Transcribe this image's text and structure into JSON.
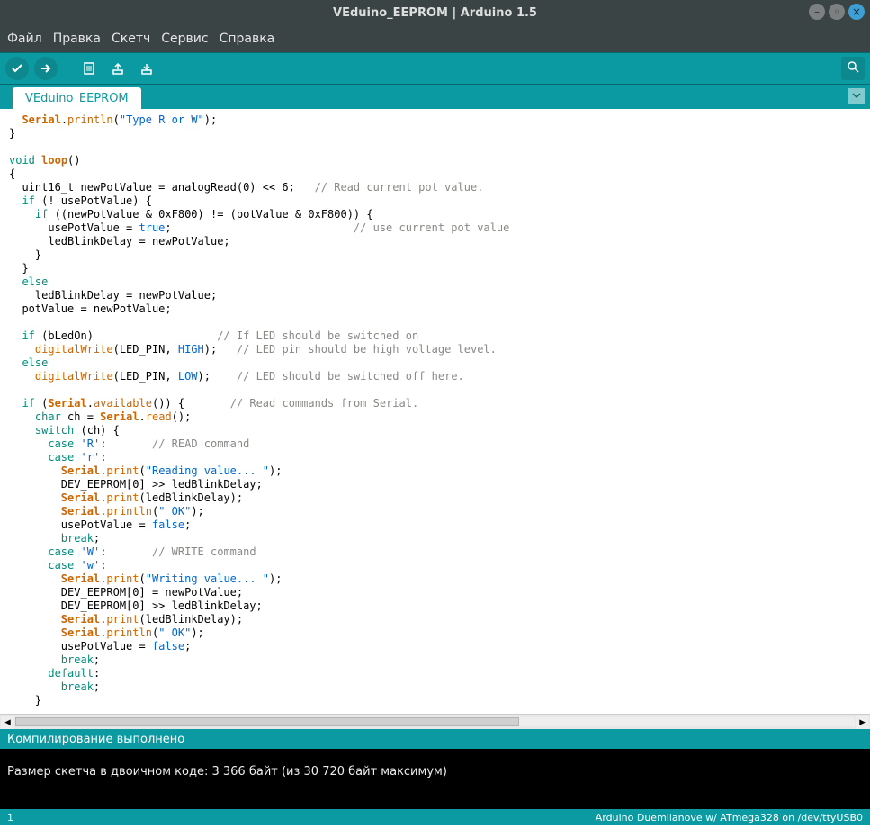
{
  "window": {
    "title": "VEduino_EEPROM | Arduino 1.5"
  },
  "menu": {
    "file": "Файл",
    "edit": "Правка",
    "sketch": "Скетч",
    "tools": "Сервис",
    "help": "Справка"
  },
  "tabs": {
    "main": "VEduino_EEPROM"
  },
  "code": {
    "l1_a": "  ",
    "l1_b": "Serial",
    "l1_c": ".",
    "l1_d": "println",
    "l1_e": "(",
    "l1_f": "\"Type R or W\"",
    "l1_g": ");",
    "l2": "}",
    "l3": "",
    "l4_a": "void",
    "l4_b": " ",
    "l4_c": "loop",
    "l4_d": "()",
    "l5": "{",
    "l6_a": "  uint16_t newPotValue = analogRead(0) << 6;   ",
    "l6_b": "// Read current pot value.",
    "l7_a": "  ",
    "l7_b": "if",
    "l7_c": " (! usePotValue) {",
    "l8_a": "    ",
    "l8_b": "if",
    "l8_c": " ((newPotValue & 0xF800) != (potValue & 0xF800)) {",
    "l9_a": "      usePotValue = ",
    "l9_b": "true",
    "l9_c": ";                            ",
    "l9_d": "// use current pot value",
    "l10": "      ledBlinkDelay = newPotValue;",
    "l11": "    }",
    "l12": "  }",
    "l13_a": "  ",
    "l13_b": "else",
    "l14": "    ledBlinkDelay = newPotValue;",
    "l15": "  potValue = newPotValue;",
    "l16": "",
    "l17_a": "  ",
    "l17_b": "if",
    "l17_c": " (bLedOn)                   ",
    "l17_d": "// If LED should be switched on",
    "l18_a": "    ",
    "l18_b": "digitalWrite",
    "l18_c": "(LED_PIN, ",
    "l18_d": "HIGH",
    "l18_e": ");   ",
    "l18_f": "// LED pin should be high voltage level.",
    "l19_a": "  ",
    "l19_b": "else",
    "l20_a": "    ",
    "l20_b": "digitalWrite",
    "l20_c": "(LED_PIN, ",
    "l20_d": "LOW",
    "l20_e": ");    ",
    "l20_f": "// LED should be switched off here.",
    "l21": "",
    "l22_a": "  ",
    "l22_b": "if",
    "l22_c": " (",
    "l22_d": "Serial",
    "l22_e": ".",
    "l22_f": "available",
    "l22_g": "()) {       ",
    "l22_h": "// Read commands from Serial.",
    "l23_a": "    ",
    "l23_b": "char",
    "l23_c": " ch = ",
    "l23_d": "Serial",
    "l23_e": ".",
    "l23_f": "read",
    "l23_g": "();",
    "l24_a": "    ",
    "l24_b": "switch",
    "l24_c": " (ch) {",
    "l25_a": "      ",
    "l25_b": "case",
    "l25_c": " ",
    "l25_d": "'R'",
    "l25_e": ":       ",
    "l25_f": "// READ command",
    "l26_a": "      ",
    "l26_b": "case",
    "l26_c": " ",
    "l26_d": "'r'",
    "l26_e": ":",
    "l27_a": "        ",
    "l27_b": "Serial",
    "l27_c": ".",
    "l27_d": "print",
    "l27_e": "(",
    "l27_f": "\"Reading value... \"",
    "l27_g": ");",
    "l28": "        DEV_EEPROM[0] >> ledBlinkDelay;",
    "l29_a": "        ",
    "l29_b": "Serial",
    "l29_c": ".",
    "l29_d": "print",
    "l29_e": "(ledBlinkDelay);",
    "l30_a": "        ",
    "l30_b": "Serial",
    "l30_c": ".",
    "l30_d": "println",
    "l30_e": "(",
    "l30_f": "\" OK\"",
    "l30_g": ");",
    "l31_a": "        usePotValue = ",
    "l31_b": "false",
    "l31_c": ";",
    "l32_a": "        ",
    "l32_b": "break",
    "l32_c": ";",
    "l33_a": "      ",
    "l33_b": "case",
    "l33_c": " ",
    "l33_d": "'W'",
    "l33_e": ":       ",
    "l33_f": "// WRITE command",
    "l34_a": "      ",
    "l34_b": "case",
    "l34_c": " ",
    "l34_d": "'w'",
    "l34_e": ":",
    "l35_a": "        ",
    "l35_b": "Serial",
    "l35_c": ".",
    "l35_d": "print",
    "l35_e": "(",
    "l35_f": "\"Writing value... \"",
    "l35_g": ");",
    "l36": "        DEV_EEPROM[0] = newPotValue;",
    "l37": "        DEV_EEPROM[0] >> ledBlinkDelay;",
    "l38_a": "        ",
    "l38_b": "Serial",
    "l38_c": ".",
    "l38_d": "print",
    "l38_e": "(ledBlinkDelay);",
    "l39_a": "        ",
    "l39_b": "Serial",
    "l39_c": ".",
    "l39_d": "println",
    "l39_e": "(",
    "l39_f": "\" OK\"",
    "l39_g": ");",
    "l40_a": "        usePotValue = ",
    "l40_b": "false",
    "l40_c": ";",
    "l41_a": "        ",
    "l41_b": "break",
    "l41_c": ";",
    "l42_a": "      ",
    "l42_b": "default",
    "l42_c": ":",
    "l43_a": "        ",
    "l43_b": "break",
    "l43_c": ";",
    "l44": "    }"
  },
  "status": {
    "message": "Компилирование выполнено"
  },
  "console": {
    "line1": "Размер скетча в двоичном коде: 3 366 байт (из 30 720 байт максимум)"
  },
  "footer": {
    "line": "1",
    "board": "Arduino Duemilanove w/ ATmega328 on /dev/ttyUSB0"
  }
}
